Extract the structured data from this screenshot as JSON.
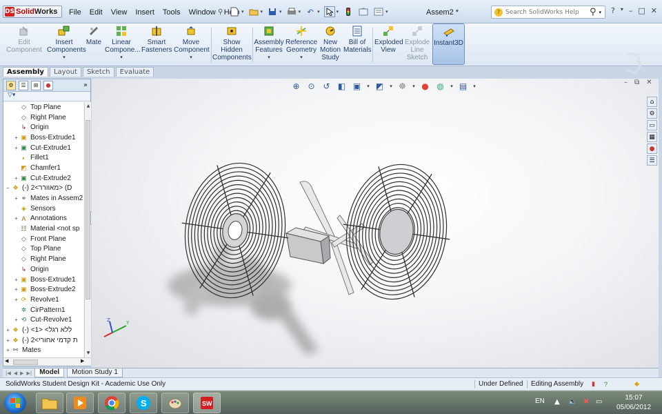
{
  "app": {
    "logo_prefix": "DS",
    "logo_solid": "Solid",
    "logo_works": "Works",
    "document_title": "Assem2 *",
    "accent": "#d21f1f"
  },
  "menus": [
    "File",
    "Edit",
    "View",
    "Insert",
    "Tools",
    "Window",
    "Help"
  ],
  "search": {
    "placeholder": "Search SolidWorks Help"
  },
  "window_controls": [
    "?",
    "▾",
    "–",
    "□",
    "✕"
  ],
  "ribbon": [
    {
      "key": "edit_component",
      "label": "Edit Component",
      "icon": "edit-component-icon",
      "disabled": true,
      "dropdown": false
    },
    {
      "key": "insert_components",
      "label": "Insert Components",
      "icon": "insert-components-icon",
      "disabled": false,
      "dropdown": true
    },
    {
      "key": "mate",
      "label": "Mate",
      "icon": "mate-icon",
      "disabled": false,
      "dropdown": false
    },
    {
      "key": "linear_component",
      "label": "Linear Compone...",
      "icon": "linear-pattern-icon",
      "disabled": false,
      "dropdown": true
    },
    {
      "key": "smart_fasteners",
      "label": "Smart Fasteners",
      "icon": "smart-fasteners-icon",
      "disabled": false,
      "dropdown": false
    },
    {
      "key": "move_component",
      "label": "Move Component",
      "icon": "move-component-icon",
      "disabled": false,
      "dropdown": true
    },
    {
      "key": "show_hidden",
      "label": "Show Hidden Components",
      "icon": "show-hidden-icon",
      "disabled": false,
      "dropdown": false
    },
    {
      "key": "assembly_features",
      "label": "Assembly Features",
      "icon": "assembly-features-icon",
      "disabled": false,
      "dropdown": true
    },
    {
      "key": "reference_geometry",
      "label": "Reference Geometry",
      "icon": "reference-geometry-icon",
      "disabled": false,
      "dropdown": true
    },
    {
      "key": "new_motion_study",
      "label": "New Motion Study",
      "icon": "motion-study-icon",
      "disabled": false,
      "dropdown": false
    },
    {
      "key": "bill_of_materials",
      "label": "Bill of Materials",
      "icon": "bom-icon",
      "disabled": false,
      "dropdown": false
    },
    {
      "key": "exploded_view",
      "label": "Exploded View",
      "icon": "exploded-view-icon",
      "disabled": false,
      "dropdown": false
    },
    {
      "key": "explode_line_sketch",
      "label": "Explode Line Sketch",
      "icon": "explode-line-sketch-icon",
      "disabled": true,
      "dropdown": false
    },
    {
      "key": "instant3d",
      "label": "Instant3D",
      "icon": "instant3d-icon",
      "disabled": false,
      "dropdown": false,
      "active": true
    }
  ],
  "command_tabs": [
    {
      "label": "Assembly",
      "active": true
    },
    {
      "label": "Layout",
      "active": false
    },
    {
      "label": "Sketch",
      "active": false
    },
    {
      "label": "Evaluate",
      "active": false
    }
  ],
  "tree": [
    {
      "label": "Top Plane",
      "icon": "plane-icon",
      "indent": 1,
      "expander": ""
    },
    {
      "label": "Right Plane",
      "icon": "plane-icon",
      "indent": 1,
      "expander": ""
    },
    {
      "label": "Origin",
      "icon": "origin-icon",
      "indent": 1,
      "expander": ""
    },
    {
      "label": "Boss-Extrude1",
      "icon": "extrude-icon",
      "indent": 1,
      "expander": "+"
    },
    {
      "label": "Cut-Extrude1",
      "icon": "cut-extrude-icon",
      "indent": 1,
      "expander": "+"
    },
    {
      "label": "Fillet1",
      "icon": "fillet-icon",
      "indent": 1,
      "expander": ""
    },
    {
      "label": "Chamfer1",
      "icon": "chamfer-icon",
      "indent": 1,
      "expander": ""
    },
    {
      "label": "Cut-Extrude2",
      "icon": "cut-extrude-icon",
      "indent": 1,
      "expander": "+"
    },
    {
      "label": "(-) 2<מאוורר> (D",
      "icon": "part-icon",
      "indent": 0,
      "expander": "−"
    },
    {
      "label": "Mates in Assem2",
      "icon": "mates-icon",
      "indent": 1,
      "expander": "+"
    },
    {
      "label": "Sensors",
      "icon": "sensors-icon",
      "indent": 1,
      "expander": ""
    },
    {
      "label": "Annotations",
      "icon": "annotations-icon",
      "indent": 1,
      "expander": "+"
    },
    {
      "label": "Material <not sp",
      "icon": "material-icon",
      "indent": 1,
      "expander": ""
    },
    {
      "label": "Front Plane",
      "icon": "plane-icon",
      "indent": 1,
      "expander": ""
    },
    {
      "label": "Top Plane",
      "icon": "plane-icon",
      "indent": 1,
      "expander": ""
    },
    {
      "label": "Right Plane",
      "icon": "plane-icon",
      "indent": 1,
      "expander": ""
    },
    {
      "label": "Origin",
      "icon": "origin-icon",
      "indent": 1,
      "expander": ""
    },
    {
      "label": "Boss-Extrude1",
      "icon": "extrude-icon",
      "indent": 1,
      "expander": "+"
    },
    {
      "label": "Boss-Extrude2",
      "icon": "extrude-icon",
      "indent": 1,
      "expander": "+"
    },
    {
      "label": "Revolve1",
      "icon": "revolve-icon",
      "indent": 1,
      "expander": "+"
    },
    {
      "label": "CirPattern1",
      "icon": "circular-pattern-icon",
      "indent": 1,
      "expander": ""
    },
    {
      "label": "Cut-Revolve1",
      "icon": "cut-revolve-icon",
      "indent": 1,
      "expander": "+"
    },
    {
      "label": "(-) <ללא רגל> <1",
      "icon": "part-icon",
      "indent": 0,
      "expander": "+"
    },
    {
      "label": "(-) 2<ת קדמי אחורי",
      "icon": "part-icon",
      "indent": 0,
      "expander": "+"
    },
    {
      "label": "Mates",
      "icon": "mates-folder-icon",
      "indent": 0,
      "expander": "+"
    }
  ],
  "bottom_tabs": [
    {
      "label": "Model",
      "active": true
    },
    {
      "label": "Motion Study 1",
      "active": false
    }
  ],
  "status": {
    "license": "SolidWorks Student Design Kit - Academic Use Only",
    "definition": "Under Defined",
    "mode": "Editing Assembly"
  },
  "taskbar": {
    "apps": [
      "windows-explorer-icon",
      "media-player-icon",
      "chrome-icon",
      "skype-icon",
      "paint-icon",
      "solidworks-icon"
    ],
    "language": "EN",
    "time": "15:07",
    "date": "05/06/2012"
  }
}
